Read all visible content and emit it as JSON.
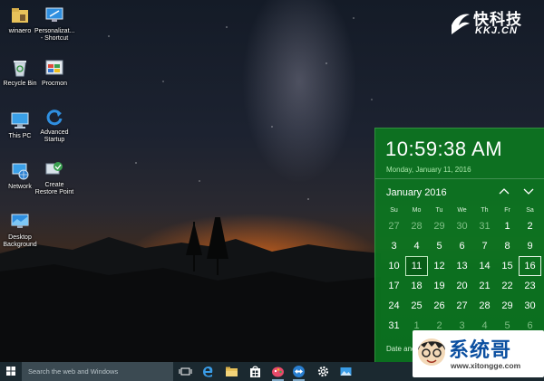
{
  "desktop": {
    "icons": [
      {
        "label": "winaero",
        "icon": "folder-icon"
      },
      {
        "label": "Personalizat...\n- Shortcut",
        "icon": "personalization-icon"
      },
      {
        "label": "Recycle Bin",
        "icon": "recycle-bin-icon"
      },
      {
        "label": "Procmon",
        "icon": "procmon-icon"
      },
      {
        "label": "This PC",
        "icon": "computer-icon"
      },
      {
        "label": "Advanced\nStartup",
        "icon": "refresh-icon"
      },
      {
        "label": "Network",
        "icon": "network-icon"
      },
      {
        "label": "Create\nRestore Point",
        "icon": "restore-point-icon"
      },
      {
        "label": "Desktop\nBackground",
        "icon": "desktop-background-icon"
      }
    ]
  },
  "watermark": {
    "title": "快科技",
    "subtitle": "KKJ.CN"
  },
  "clock_flyout": {
    "time": "10:59:38 AM",
    "date": "Monday, January 11, 2016",
    "month_label": "January 2016",
    "weekdays": [
      "Su",
      "Mo",
      "Tu",
      "We",
      "Th",
      "Fr",
      "Sa"
    ],
    "days": [
      [
        "27",
        "28",
        "29",
        "30",
        "31",
        "1",
        "2"
      ],
      [
        "3",
        "4",
        "5",
        "6",
        "7",
        "8",
        "9"
      ],
      [
        "10",
        "11",
        "12",
        "13",
        "14",
        "15",
        "16"
      ],
      [
        "17",
        "18",
        "19",
        "20",
        "21",
        "22",
        "23"
      ],
      [
        "24",
        "25",
        "26",
        "27",
        "28",
        "29",
        "30"
      ],
      [
        "31",
        "1",
        "2",
        "3",
        "4",
        "5",
        "6"
      ]
    ],
    "dim_cells": [
      "0-0",
      "0-1",
      "0-2",
      "0-3",
      "0-4",
      "5-1",
      "5-2",
      "5-3",
      "5-4",
      "5-5",
      "5-6"
    ],
    "selected_cell": "2-1",
    "today_cell": "2-6",
    "footer": "Date and"
  },
  "taskbar": {
    "search_placeholder": "Search the web and Windows",
    "apps": [
      "task-view-icon",
      "edge-icon",
      "file-explorer-icon",
      "store-icon",
      "paint-icon",
      "teamviewer-icon",
      "settings-icon",
      "photos-icon"
    ]
  },
  "ad_badge": {
    "title": "系统哥",
    "url": "www.xitongge.com"
  },
  "colors": {
    "flyout": "#0c7620",
    "taskbar": "#1b2930",
    "accent": "#7fa8c6"
  }
}
